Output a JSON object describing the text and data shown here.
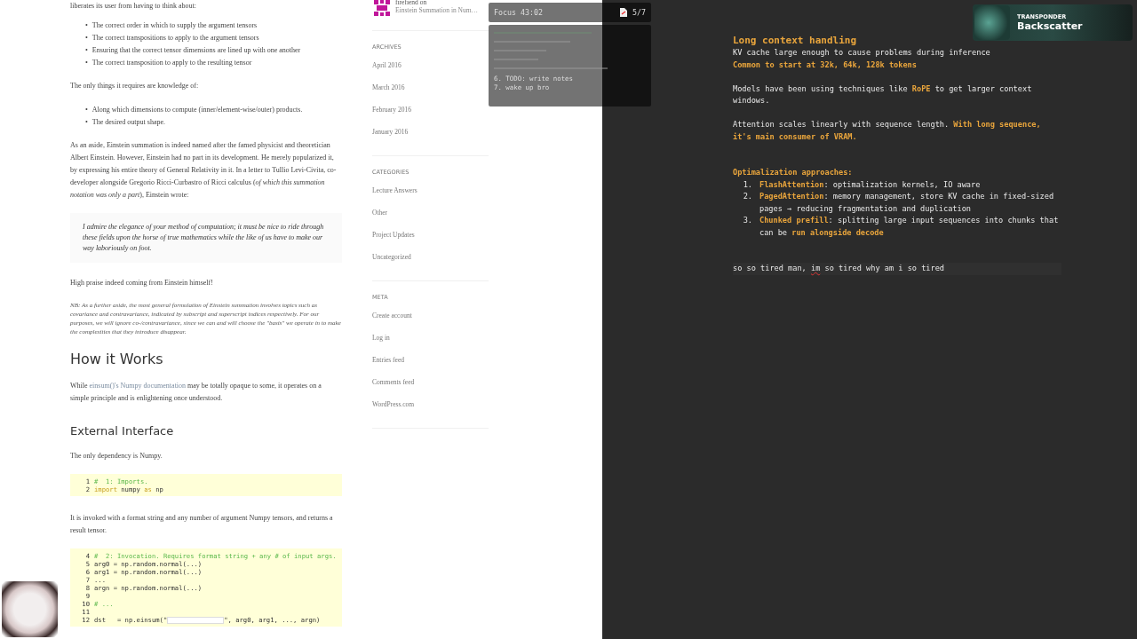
{
  "article": {
    "bullet": "•",
    "intro": "liberates its user from having to think about:",
    "bullets_1": [
      "The correct order in which to supply the argument tensors",
      "The correct transpositions to apply to the argument tensors",
      "Ensuring that the correct tensor dimensions are lined up with one another",
      "The correct transposition to apply to the resulting tensor"
    ],
    "requires": "The only things it requires are knowledge of:",
    "bullets_2": [
      "Along which dimensions to compute (inner/element-wise/outer) products.",
      "The desired output shape."
    ],
    "aside": "As an aside, Einstein summation is indeed named after the famed physicist and theoretician Albert Einstein. However, Einstein had no part in its development. He merely popularized it, by expressing his entire theory of General Relativity in it. In a letter to Tullio Levi-Civita, co-developer alongside Gregorio Ricci-Curbastro of Ricci calculus (*of which this summation notation was only a part*), Einstein wrote:",
    "quote": "I admire the elegance of your method of computation; it must be nice to ride through these fields upon the horse of true mathematics while the like of us have to make our way laboriously on foot.",
    "praise": "High praise indeed coming from Einstein himself!",
    "note": "NB: As a further aside, the most general formulation of Einstein summation involves topics such as covariance and contravariance, indicated by subscript and superscript indices respectively. For our purposes, we will ignore co-/contravariance, since we can and will choose the \"basis\" we operate in to make the complexities that they introduce disappear.",
    "heading_1": "How it Works",
    "how": {
      "before": "While ",
      "link": "einsum()'s Numpy documentation",
      "after": " may be totally opaque to some, it operates on a simple principle and is enlightening once understood."
    },
    "heading_2": "External Interface",
    "dependency": "The only dependency is Numpy.",
    "code_1": [
      {
        "n": "1",
        "segments": [
          {
            "text": "#  1: Imports.",
            "kind": "comment"
          }
        ]
      },
      {
        "n": "2",
        "segments": [
          {
            "text": "import",
            "kind": "keyword"
          },
          {
            "text": " numpy ",
            "kind": "plain"
          },
          {
            "text": "as",
            "kind": "keyword"
          },
          {
            "text": " np",
            "kind": "plain"
          }
        ]
      }
    ],
    "invoked": "It is invoked with a format string and any number of argument Numpy tensors, and returns a result tensor.",
    "code_2": [
      {
        "n": "4",
        "segments": [
          {
            "text": "#  2: Invocation. Requires format string + any # of input args.",
            "kind": "comment"
          }
        ]
      },
      {
        "n": "5",
        "segments": [
          {
            "text": "arg0 = np.random.normal(...)",
            "kind": "plain"
          }
        ]
      },
      {
        "n": "6",
        "segments": [
          {
            "text": "arg1 = np.random.normal(...)",
            "kind": "plain"
          }
        ]
      },
      {
        "n": "7",
        "segments": [
          {
            "text": "...",
            "kind": "plain"
          }
        ]
      },
      {
        "n": "8",
        "segments": [
          {
            "text": "argn = np.random.normal(...)",
            "kind": "plain"
          }
        ]
      },
      {
        "n": "9"
      },
      {
        "n": "10",
        "segments": [
          {
            "text": "# ...",
            "kind": "comment"
          }
        ]
      },
      {
        "n": "11"
      },
      {
        "n": "12",
        "segments": [
          {
            "text": "dst   = np.einsum(\"",
            "kind": "plain"
          },
          {
            "kind": "blank"
          },
          {
            "text": "\", arg0, arg1, ..., argn)",
            "kind": "plain"
          }
        ]
      }
    ]
  },
  "sidebar": {
    "comment": {
      "author": "firefiend",
      "on": " on ",
      "post": "Einstein Summation in Num…"
    },
    "sections": [
      {
        "title": "ARCHIVES",
        "items": [
          "April 2016",
          "March 2016",
          "February 2016",
          "January 2016"
        ]
      },
      {
        "title": "CATEGORIES",
        "items": [
          "Lecture Answers",
          "Other",
          "Project Updates",
          "Uncategorized"
        ]
      },
      {
        "title": "META",
        "items": [
          "Create account",
          "Log in",
          "Entries feed",
          "Comments feed",
          "WordPress.com"
        ]
      }
    ]
  },
  "focus_widget": {
    "timer": "Focus 43:02",
    "count": "5/7",
    "notes": [
      "6. TODO: write notes",
      "7. wake up bro"
    ]
  },
  "now_playing": {
    "label": "TRANSPONDER",
    "title": "Backscatter"
  },
  "editor": {
    "blocks": [
      {
        "kind": "heading",
        "segments": [
          {
            "text": "Long context handling",
            "highlight": true
          }
        ]
      },
      {
        "kind": "line",
        "segments": [
          {
            "text": "KV cache large enough to cause problems during inference",
            "highlight": false
          }
        ]
      },
      {
        "kind": "line",
        "segments": [
          {
            "text": "Common to start at 32k, 64k, 128k tokens",
            "highlight": true
          }
        ]
      },
      {
        "kind": "blank"
      },
      {
        "kind": "line",
        "segments": [
          {
            "text": "Models have been using techniques like ",
            "highlight": false
          },
          {
            "text": "RoPE",
            "highlight": true
          },
          {
            "text": " to get larger context windows.",
            "highlight": false
          }
        ]
      },
      {
        "kind": "blank"
      },
      {
        "kind": "line",
        "segments": [
          {
            "text": "Attention scales linearly with sequence length. ",
            "highlight": false
          },
          {
            "text": "With long sequence, it's main consumer of VRAM.",
            "highlight": true
          }
        ]
      },
      {
        "kind": "blank"
      },
      {
        "kind": "blank"
      },
      {
        "kind": "line",
        "segments": [
          {
            "text": "Optimalization approaches:",
            "highlight": true
          }
        ]
      },
      {
        "kind": "item",
        "number": "1.",
        "segments": [
          {
            "text": "FlashAttention",
            "highlight": true
          },
          {
            "text": ": optimalization kernels, IO aware",
            "highlight": false
          }
        ]
      },
      {
        "kind": "item",
        "number": "2.",
        "segments": [
          {
            "text": "PagedAttention",
            "highlight": true
          },
          {
            "text": ": memory management, store KV cache in fixed-sized pages → reducing fragmentation and duplication",
            "highlight": false
          }
        ]
      },
      {
        "kind": "item",
        "number": "3.",
        "segments": [
          {
            "text": "Chunked prefill",
            "highlight": true
          },
          {
            "text": ": splitting large input sequences into chunks that can be ",
            "highlight": false
          },
          {
            "text": "run alongside decode",
            "highlight": true
          }
        ]
      },
      {
        "kind": "blank"
      },
      {
        "kind": "blank"
      }
    ],
    "current_line": [
      {
        "text": "so so tired man, ",
        "misspelled": false
      },
      {
        "text": "im",
        "misspelled": true
      },
      {
        "text": " so tired why am i so tired",
        "misspelled": false
      }
    ]
  }
}
